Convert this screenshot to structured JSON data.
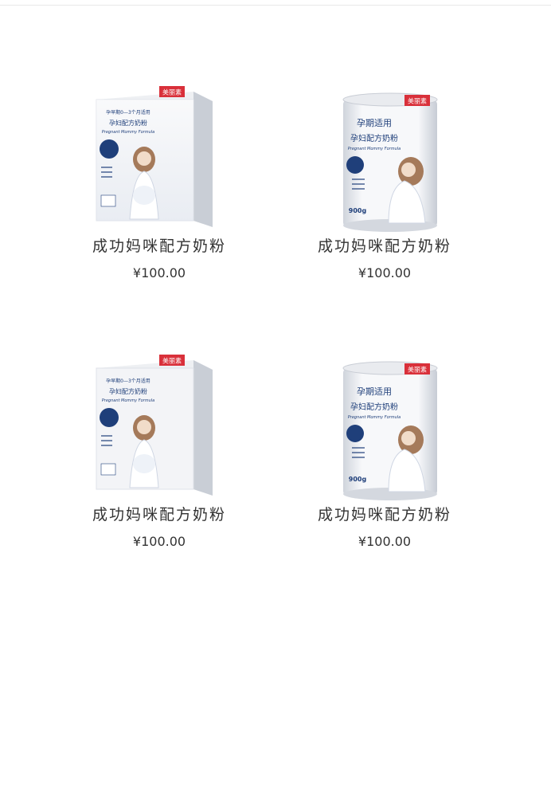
{
  "products": [
    {
      "name": "成功妈咪配方奶粉",
      "price": "¥100.00",
      "image": "box",
      "pkg": {
        "brand": "美丽素",
        "tagline": "孕早期0—3个月适用",
        "title": "孕妇配方奶粉",
        "subtitle": "Pregnant Mommy Formula"
      }
    },
    {
      "name": "成功妈咪配方奶粉",
      "price": "¥100.00",
      "image": "can",
      "pkg": {
        "brand": "美丽素",
        "tagline": "孕期适用",
        "title": "孕妇配方奶粉",
        "subtitle": "Pregnant Mommy Formula",
        "weight": "900g"
      }
    },
    {
      "name": "成功妈咪配方奶粉",
      "price": "¥100.00",
      "image": "box",
      "pkg": {
        "brand": "美丽素",
        "tagline": "孕早期0—3个月适用",
        "title": "孕妇配方奶粉",
        "subtitle": "Pregnant Mommy Formula"
      }
    },
    {
      "name": "成功妈咪配方奶粉",
      "price": "¥100.00",
      "image": "can",
      "pkg": {
        "brand": "美丽素",
        "tagline": "孕期适用",
        "title": "孕妇配方奶粉",
        "subtitle": "Pregnant Mommy Formula",
        "weight": "900g"
      }
    }
  ],
  "colors": {
    "brand_red": "#d9303a",
    "navy": "#1f3f7a",
    "text": "#333333"
  }
}
